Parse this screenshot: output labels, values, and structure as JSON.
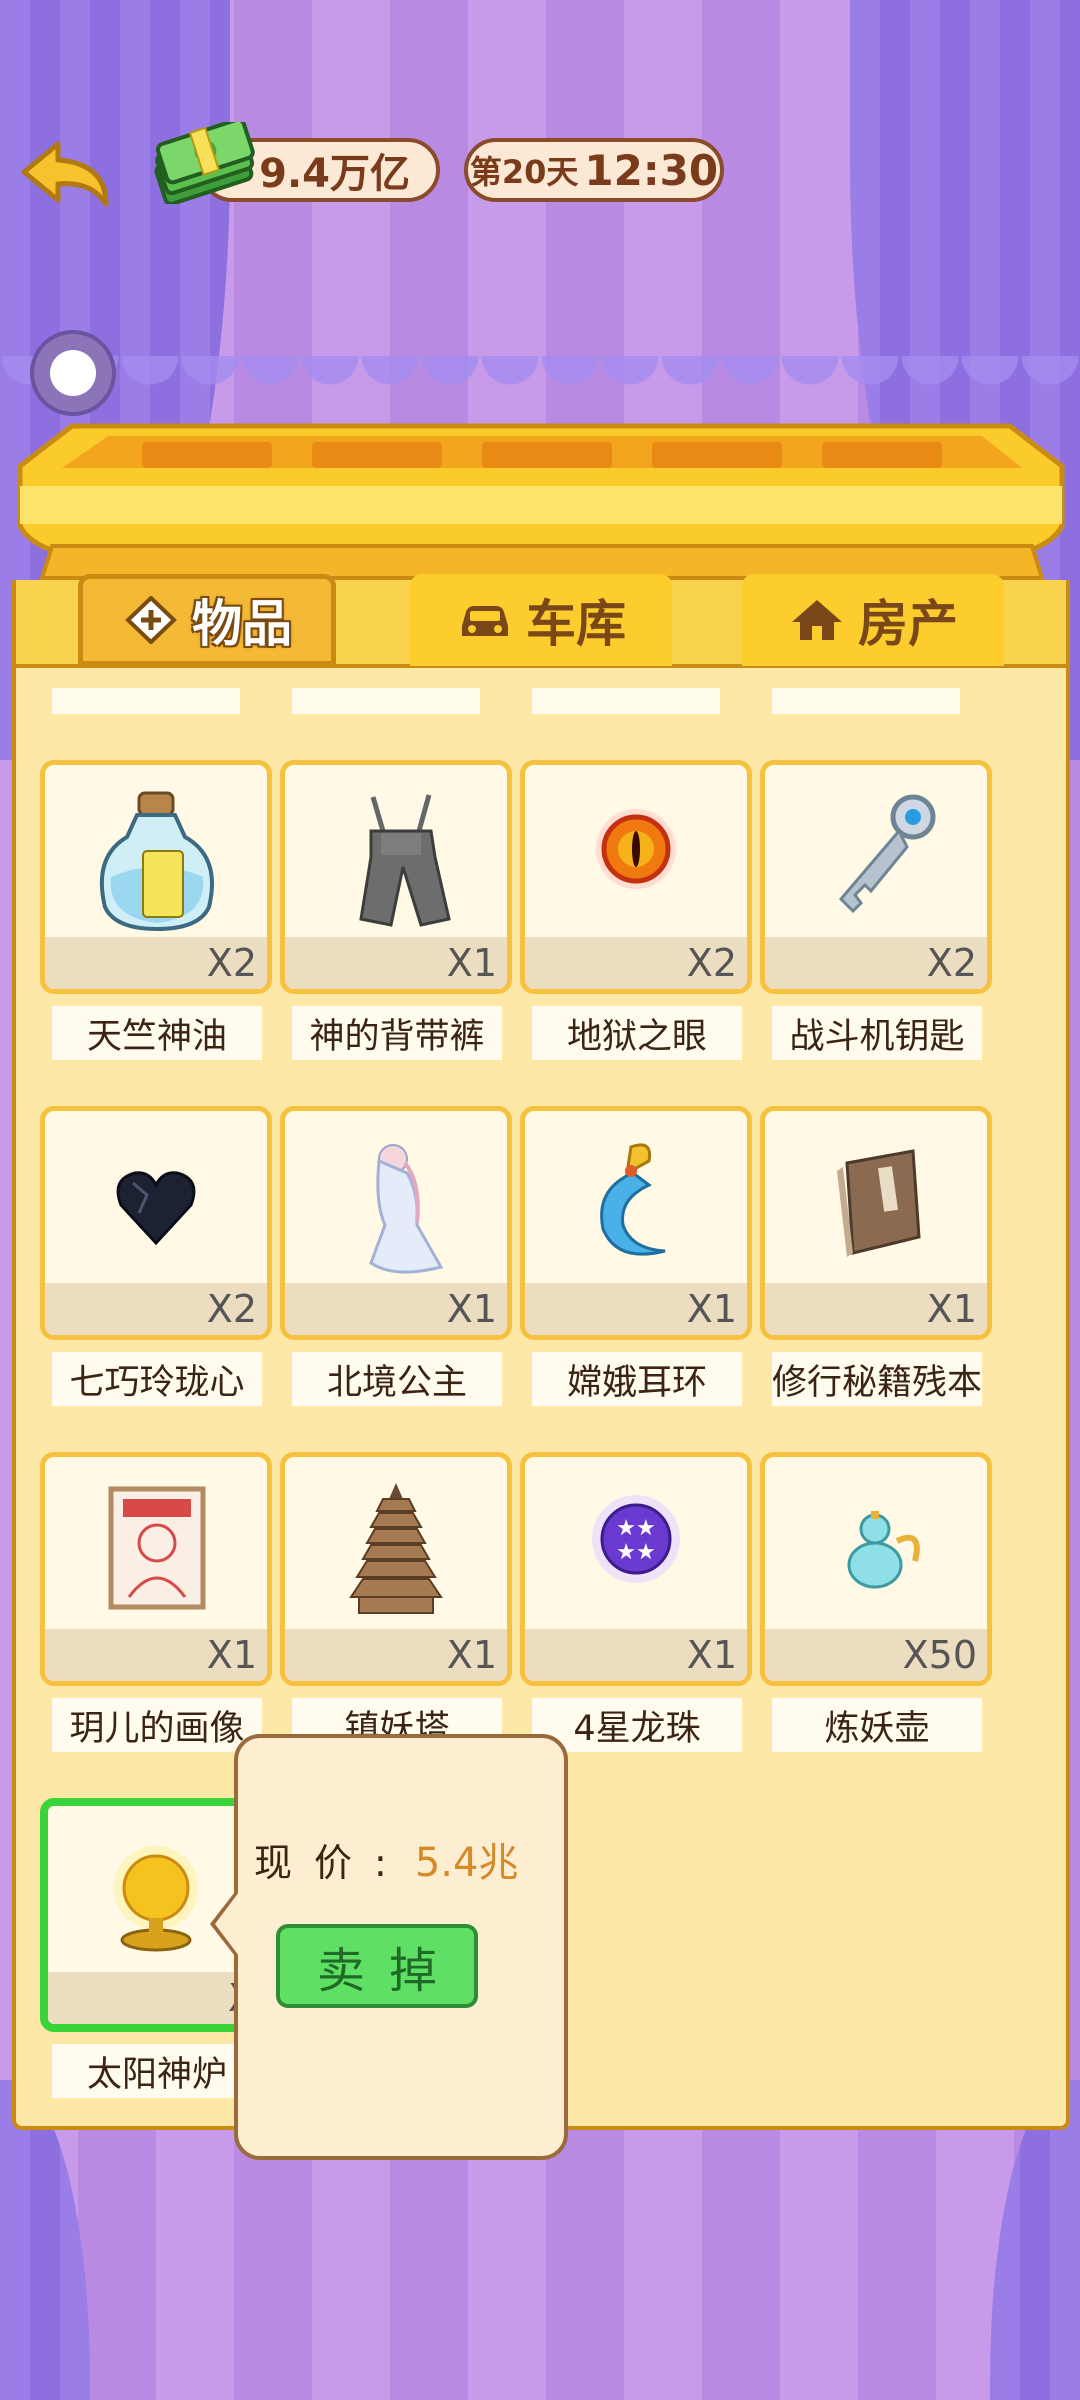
{
  "header": {
    "money": "9.4万亿",
    "day_label": "第20天",
    "time": "12:30"
  },
  "tabs": [
    {
      "label": "物品",
      "icon": "diamond-plus-icon",
      "active": true
    },
    {
      "label": "车库",
      "icon": "car-icon",
      "active": false
    },
    {
      "label": "房产",
      "icon": "house-icon",
      "active": false
    }
  ],
  "items": [
    {
      "name": "天竺神油",
      "qty": "X2",
      "icon": "oil-bottle-icon"
    },
    {
      "name": "神的背带裤",
      "qty": "X1",
      "icon": "overalls-icon"
    },
    {
      "name": "地狱之眼",
      "qty": "X2",
      "icon": "fire-eye-icon"
    },
    {
      "name": "战斗机钥匙",
      "qty": "X2",
      "icon": "key-icon"
    },
    {
      "name": "七巧玲珑心",
      "qty": "X2",
      "icon": "black-heart-gem-icon"
    },
    {
      "name": "北境公主",
      "qty": "X1",
      "icon": "princess-icon"
    },
    {
      "name": "嫦娥耳环",
      "qty": "X1",
      "icon": "earring-icon"
    },
    {
      "name": "修行秘籍残本",
      "qty": "X1",
      "icon": "book-icon"
    },
    {
      "name": "玥儿的画像",
      "qty": "X1",
      "icon": "portrait-icon"
    },
    {
      "name": "镇妖塔",
      "qty": "X1",
      "icon": "pagoda-icon"
    },
    {
      "name": "4星龙珠",
      "qty": "X1",
      "icon": "dragon-ball-icon"
    },
    {
      "name": "炼妖壶",
      "qty": "X50",
      "icon": "gourd-icon"
    },
    {
      "name": "太阳神炉",
      "qty": "X",
      "icon": "sun-furnace-icon",
      "selected": true
    }
  ],
  "popup": {
    "price_label": "现价:",
    "price_value": "5.4兆",
    "sell_label": "卖掉"
  },
  "colors": {
    "selected_border": "#39d43a",
    "sell_button": "#5fe065",
    "card_border": "#f5c13f",
    "panel_bg": "#fde8a7"
  }
}
